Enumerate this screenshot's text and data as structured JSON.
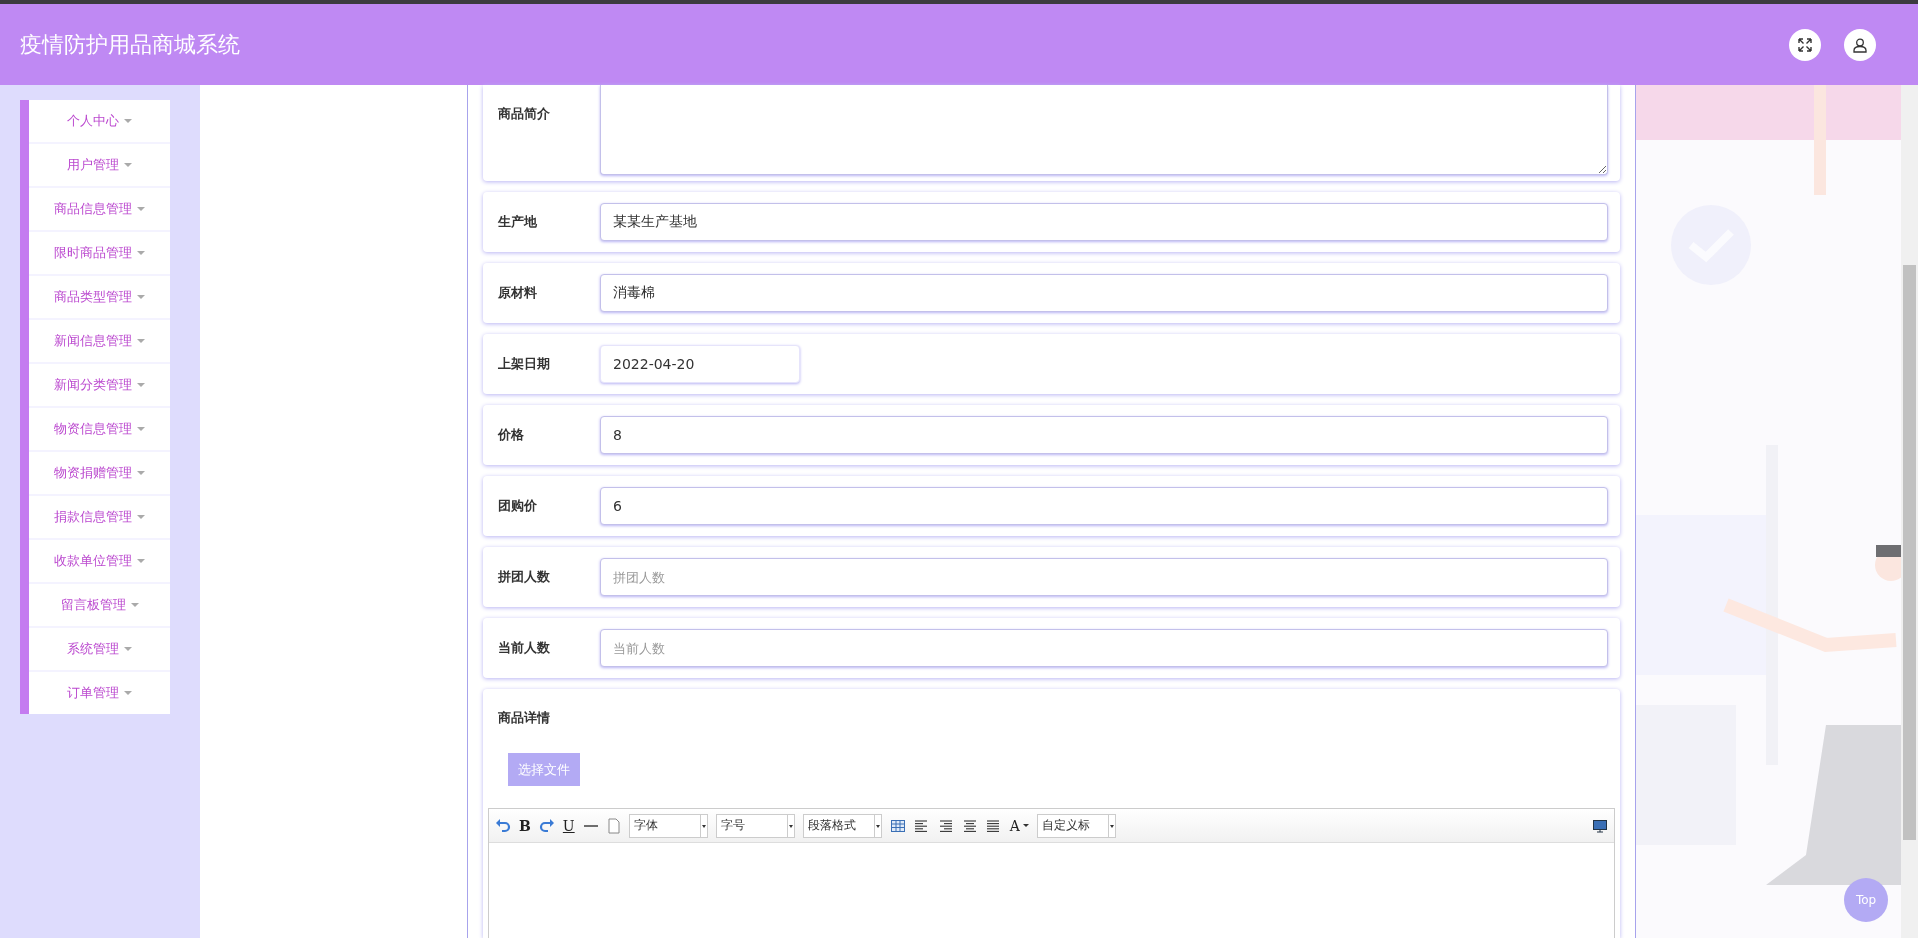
{
  "header": {
    "title": "疫情防护用品商城系统"
  },
  "sidebar": {
    "items": [
      {
        "label": "个人中心"
      },
      {
        "label": "用户管理"
      },
      {
        "label": "商品信息管理"
      },
      {
        "label": "限时商品管理"
      },
      {
        "label": "商品类型管理"
      },
      {
        "label": "新闻信息管理"
      },
      {
        "label": "新闻分类管理"
      },
      {
        "label": "物资信息管理"
      },
      {
        "label": "物资捐赠管理"
      },
      {
        "label": "捐款信息管理"
      },
      {
        "label": "收款单位管理"
      },
      {
        "label": "留言板管理"
      },
      {
        "label": "系统管理"
      },
      {
        "label": "订单管理"
      }
    ]
  },
  "form": {
    "fields": [
      {
        "label": "商品简介",
        "kind": "textarea"
      },
      {
        "label": "生产地",
        "kind": "text",
        "value": "某某生产基地"
      },
      {
        "label": "原材料",
        "kind": "text",
        "value": "消毒棉"
      },
      {
        "label": "上架日期",
        "kind": "date",
        "value": "2022-04-20"
      },
      {
        "label": "价格",
        "kind": "text",
        "value": "8"
      },
      {
        "label": "团购价",
        "kind": "text",
        "value": "6"
      },
      {
        "label": "拼团人数",
        "kind": "text",
        "placeholder": "拼团人数"
      },
      {
        "label": "当前人数",
        "kind": "text",
        "placeholder": "当前人数"
      }
    ]
  },
  "details": {
    "label": "商品详情",
    "upload_button": "选择文件",
    "toolbar": [
      {
        "kind": "undo"
      },
      {
        "kind": "bold",
        "label": "B"
      },
      {
        "kind": "redo"
      },
      {
        "kind": "underline",
        "label": "U"
      },
      {
        "kind": "hr"
      },
      {
        "kind": "page"
      },
      {
        "kind": "select",
        "label": "字体"
      },
      {
        "kind": "select",
        "label": "字号"
      },
      {
        "kind": "select",
        "label": "段落格式"
      },
      {
        "kind": "table"
      },
      {
        "kind": "align-left"
      },
      {
        "kind": "align-right"
      },
      {
        "kind": "align-center"
      },
      {
        "kind": "justify"
      },
      {
        "kind": "font-color",
        "label": "A"
      },
      {
        "kind": "select",
        "label": "自定义标"
      },
      {
        "kind": "spacer"
      },
      {
        "kind": "preview"
      }
    ]
  },
  "back_to_top": "Top"
}
